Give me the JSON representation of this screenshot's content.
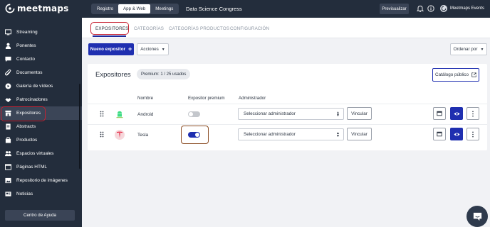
{
  "brand": {
    "name": "meetmaps"
  },
  "sidebar": {
    "items": [
      {
        "label": "Streaming",
        "icon": "streaming-icon"
      },
      {
        "label": "Ponentes",
        "icon": "speaker-icon"
      },
      {
        "label": "Contacto",
        "icon": "contact-icon"
      },
      {
        "label": "Documentos",
        "icon": "document-icon"
      },
      {
        "label": "Galería de vídeos",
        "icon": "video-icon"
      },
      {
        "label": "Patrocinadores",
        "icon": "sponsor-icon"
      },
      {
        "label": "Expositores",
        "icon": "store-icon",
        "active": true
      },
      {
        "label": "Abstracts",
        "icon": "abstract-icon"
      },
      {
        "label": "Productos",
        "icon": "product-icon"
      },
      {
        "label": "Espacios virtuales",
        "icon": "space-icon"
      },
      {
        "label": "Páginas HTML",
        "icon": "html-icon"
      },
      {
        "label": "Repositorio de imágenes",
        "icon": "image-icon"
      },
      {
        "label": "Noticias",
        "icon": "news-icon"
      }
    ],
    "help_label": "Centro de Ayuda"
  },
  "topbar": {
    "segments": [
      "Registro",
      "App & Web",
      "Meetings"
    ],
    "active_segment": "App & Web",
    "event_title": "Data Science Congress",
    "preview_label": "Previsualizar",
    "user_name": "Meetmaps Events"
  },
  "tabs": {
    "items": [
      "EXPOSITORES",
      "CATEGORÍAS",
      "CATEGORÍAS PRODUCTOS",
      "CONFIGURACIÓN"
    ],
    "active": "EXPOSITORES"
  },
  "toolbar": {
    "new_label": "Nuevo expositor",
    "actions_label": "Acciones",
    "sort_label": "Ordenar por"
  },
  "exhibitors": {
    "title": "Expositores",
    "premium_pill": "Premium: 1 / 25 usados",
    "public_catalog_label": "Catálogo público",
    "columns": {
      "name": "Nombre",
      "premium": "Expositor premium",
      "admin": "Administrador"
    },
    "rows": [
      {
        "name": "Android",
        "premium": false,
        "admin_select": "Seleccionar administrador",
        "link_label": "Vincular"
      },
      {
        "name": "Tesla",
        "premium": true,
        "admin_select": "Seleccionar administrador",
        "link_label": "Vincular"
      }
    ]
  },
  "colors": {
    "sidebar_bg": "#232d3c",
    "primary": "#1f2fb0",
    "highlight": "#c72232",
    "toggle_on": "#1f2fb0",
    "toggle_off": "#c4c7cc",
    "android": "#3ddc84",
    "tesla": "#e31937"
  }
}
